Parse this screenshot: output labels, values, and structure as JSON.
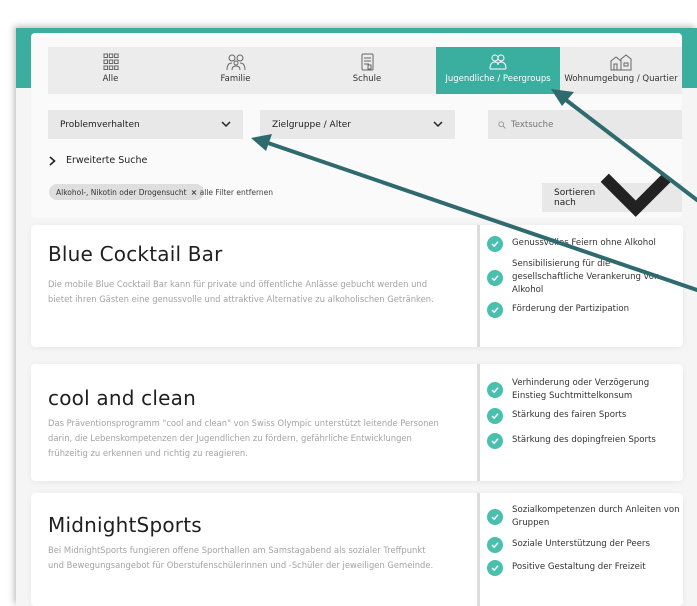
{
  "tabs": [
    {
      "label": "Alle",
      "icon": "grid-icon"
    },
    {
      "label": "Familie",
      "icon": "family-icon"
    },
    {
      "label": "Schule",
      "icon": "school-icon"
    },
    {
      "label": "Jugendliche / Peergroups",
      "icon": "youth-icon",
      "active": true
    },
    {
      "label": "Wohnumgebung / Quartier",
      "icon": "neighborhood-icon"
    }
  ],
  "filters": {
    "problem_label": "Problemverhalten",
    "target_label": "Zielgruppe / Alter",
    "search_placeholder": "Textsuche",
    "advanced_label": "Erweiterte Suche",
    "active_chip": "Alkohol-, Nikotin oder Drogensucht",
    "chip_remove": "×",
    "clear_all": "× alle Filter entfernen",
    "sort_label": "Sortieren nach"
  },
  "cards": [
    {
      "title": "Blue Cocktail Bar",
      "description": "Die mobile Blue Cocktail Bar kann für private und öffentliche Anlässe gebucht werden und bietet ihren Gästen eine genussvolle und attraktive Alternative zu alkoholischen Getränken.",
      "goals": [
        "Genussvolles Feiern ohne Alkohol",
        "Sensibilisierung für die gesellschaftliche Verankerung von Alkohol",
        "Förderung der Partizipation"
      ]
    },
    {
      "title": "cool and clean",
      "description": "Das Präventionsprogramm \"cool and clean\" von Swiss Olympic unterstützt leitende Personen darin, die Lebenskompetenzen der Jugendlichen zu fördern, gefährliche Entwicklungen frühzeitig zu erkennen und richtig zu reagieren.",
      "goals": [
        "Verhinderung oder Verzögerung Einstieg Suchtmittelkonsum",
        "Stärkung des fairen Sports",
        "Stärkung des dopingfreien Sports"
      ]
    },
    {
      "title": "MidnightSports",
      "description": "Bei MidnightSports fungieren offene Sporthallen am Samstagabend als sozialer Treffpunkt und Bewegungsangebot für Oberstufenschülerinnen und -Schüler der jeweiligen Gemeinde.",
      "goals": [
        "Sozialkompetenzen durch Anleiten von Gruppen",
        "Soziale Unterstützung der Peers",
        "Positive Gestaltung der Freizeit"
      ]
    }
  ],
  "colors": {
    "accent": "#3aafa0",
    "check": "#49bfae",
    "arrow": "#2f6a6f"
  }
}
